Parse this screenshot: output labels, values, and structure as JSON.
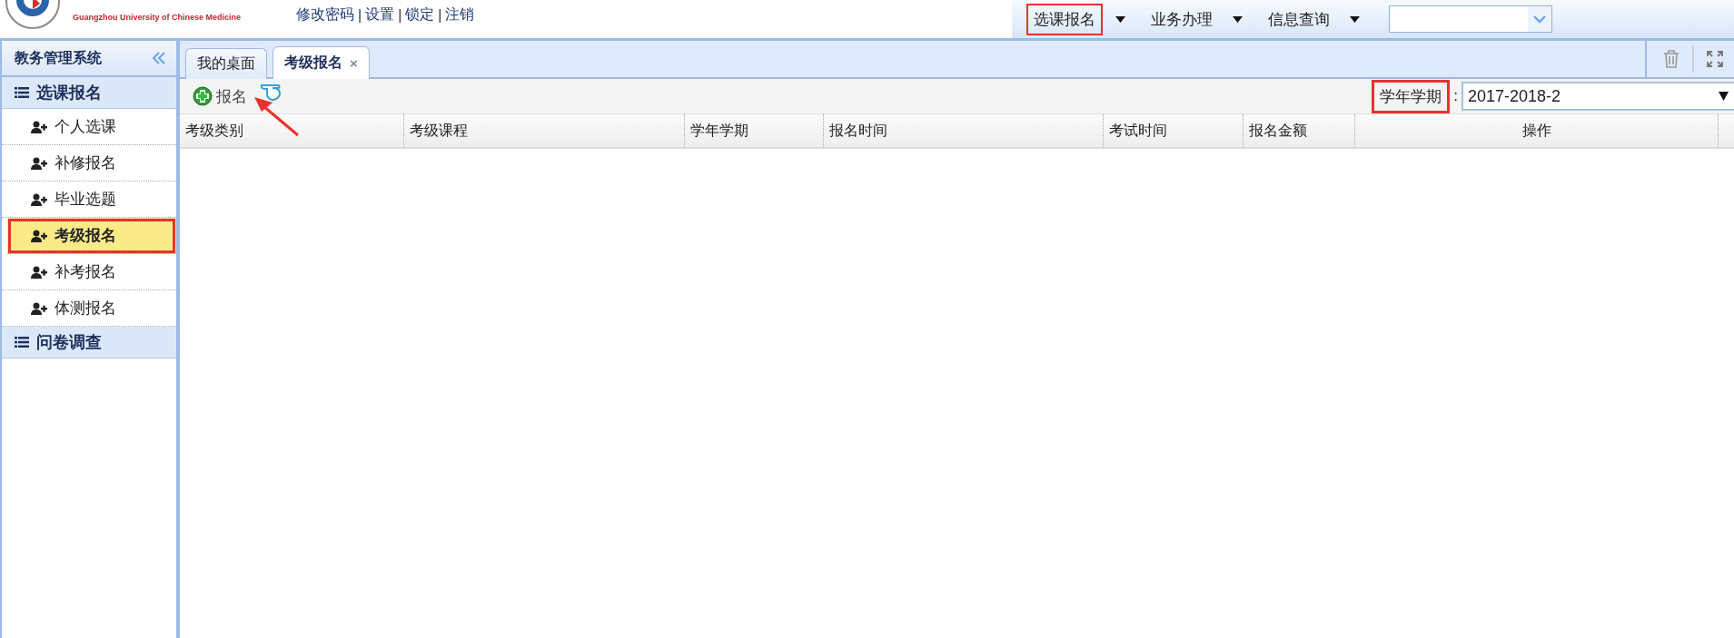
{
  "header": {
    "logo_caption": "Guangzhou University of Chinese Medicine",
    "links": [
      "修改密码",
      "设置",
      "锁定",
      "注销"
    ],
    "link_separator": "|",
    "menus": [
      {
        "label": "选课报名",
        "highlighted": true
      },
      {
        "label": "业务办理",
        "highlighted": false
      },
      {
        "label": "信息查询",
        "highlighted": false
      }
    ]
  },
  "sidebar": {
    "title": "教务管理系统",
    "sections": [
      {
        "label": "选课报名",
        "items": [
          {
            "label": "个人选课",
            "selected": false,
            "highlighted": false
          },
          {
            "label": "补修报名",
            "selected": false,
            "highlighted": false
          },
          {
            "label": "毕业选题",
            "selected": false,
            "highlighted": false
          },
          {
            "label": "考级报名",
            "selected": true,
            "highlighted": true
          },
          {
            "label": "补考报名",
            "selected": false,
            "highlighted": false
          },
          {
            "label": "体测报名",
            "selected": false,
            "highlighted": false
          }
        ]
      },
      {
        "label": "问卷调查"
      }
    ]
  },
  "tabs": [
    {
      "label": "我的桌面",
      "selected": false
    },
    {
      "label": "考级报名",
      "selected": true,
      "close": "×"
    }
  ],
  "toolbar": {
    "button": "报名",
    "term_label": "学年学期",
    "term_label_highlighted": true,
    "term_separator": ":",
    "term_value": "2017-2018-2"
  },
  "table": {
    "columns": [
      "考级类别",
      "考级课程",
      "学年学期",
      "报名时间",
      "考试时间",
      "报名金额",
      "操作"
    ]
  }
}
